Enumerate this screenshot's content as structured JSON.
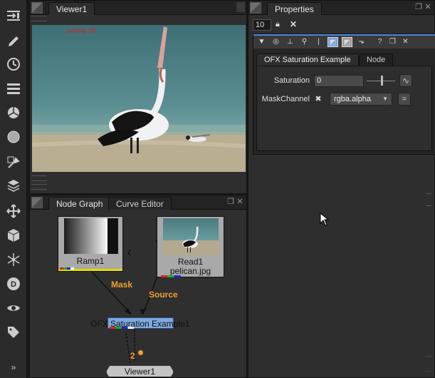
{
  "toolbar": {
    "icons": [
      "viewer-input-icon",
      "paint-brush-icon",
      "time-icon",
      "channel-icon",
      "color-icon",
      "filter-icon",
      "keyer-icon",
      "merge-icon",
      "transform-icon",
      "3d-icon",
      "particles-icon",
      "d-icon",
      "eye-icon",
      "tag-icon"
    ],
    "more": "»"
  },
  "viewer": {
    "tab_label": "Viewer1",
    "overlay_text": "overlay off"
  },
  "properties": {
    "tab_label": "Properties",
    "max_panels": "10",
    "node_tab": "OFX Saturation Example",
    "node_tab_other": "Node",
    "saturation_label": "Saturation",
    "saturation_value": "0",
    "mask_label": "MaskChannel",
    "mask_value": "rgba.alpha",
    "eq_label": "="
  },
  "graph": {
    "tab_node_graph": "Node Graph",
    "tab_curve_editor": "Curve Editor",
    "nodes": {
      "ramp": "Ramp1",
      "read": "Read1",
      "read_file": "pelican.jpg",
      "ofx": "OFX Saturation Example1",
      "viewer": "Viewer1"
    },
    "edges": {
      "mask": "Mask",
      "source": "Source"
    },
    "viewer_input_num": "2"
  },
  "colors": {
    "accent_blue": "#4a8ad8",
    "ofx_node": "#7ea9df",
    "edge_label": "#f0a032"
  }
}
